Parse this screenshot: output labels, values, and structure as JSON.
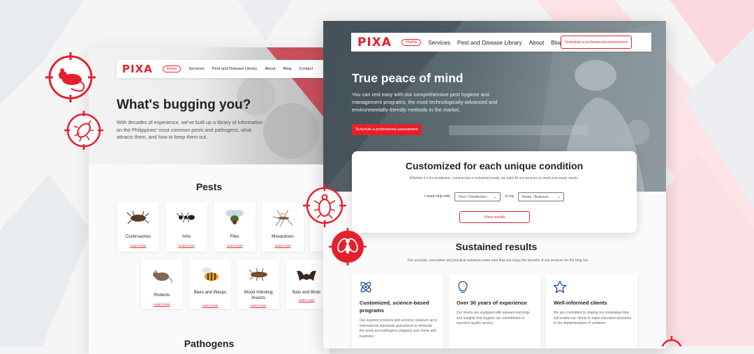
{
  "colors": {
    "brand_red": "#e5202e",
    "blue_icon": "#1a4f9c"
  },
  "left_page": {
    "logo": "PIXA",
    "nav": {
      "home": "Home",
      "links": [
        "Services",
        "Pest and Disease Library",
        "About",
        "Blog",
        "Contact"
      ]
    },
    "hero_title": "What's bugging you?",
    "hero_desc": "With decades of experience, we've built up a library of information on the Philippines' most common pests and pathogens, what attracts them, and how to keep them out.",
    "pests_title": "Pests",
    "learn_more": "Learn more",
    "pests_row1": [
      "Cockroaches",
      "Ants",
      "Flies",
      "Mosquitoes"
    ],
    "pests_row2": [
      "Rodents",
      "Bees and Wasps",
      "Wood Infesting Insects",
      "Bats and Birds"
    ],
    "pathogens_title": "Pathogens"
  },
  "right_page": {
    "logo": "PIXA",
    "nav": {
      "home": "Home",
      "links": [
        "Services",
        "Pest and Disease Library",
        "About",
        "Blog"
      ]
    },
    "nav_cta": "Schedule a professional assessment",
    "hero_title": "True peace of mind",
    "hero_desc": "You can rest easy with our comprehensive pest hygiene and management programs, the most technologically-advanced and environmentally-friendly methods in the market.",
    "hero_cta": "Schedule a professional assessment",
    "custom_title": "Customized for each unique condition",
    "custom_sub": "Whether it's for residential, commercial or industrial needs, we tailor fit our services to meet your exact needs.",
    "form": {
      "need_label": "I need help with",
      "need_value": "Pest / Disinfection",
      "in_label": "in my",
      "place_value": "Home / Business",
      "submit": "View results"
    },
    "sustained_title": "Sustained results",
    "sustained_sub": "Our accurate, innovative and practical solutions make sure that you enjoy the benefits of our services for the long run.",
    "features": [
      {
        "icon": "atom-icon",
        "title": "Customized, science-based programs",
        "desc": "Our superior products and services measure up to international standards guaranteed to eliminate the pests and pathogens plaguing your home and business."
      },
      {
        "icon": "lightbulb-icon",
        "title": "Over 30 years of experience",
        "desc": "Our teams are equipped with relevant learnings and insights that support our commitment to topnotch quality service."
      },
      {
        "icon": "star-icon",
        "title": "Well-informed clients",
        "desc": "We are committed to sharing our knowledge that will enable our clients to make educated decisions in the implementation of solutions."
      }
    ]
  }
}
